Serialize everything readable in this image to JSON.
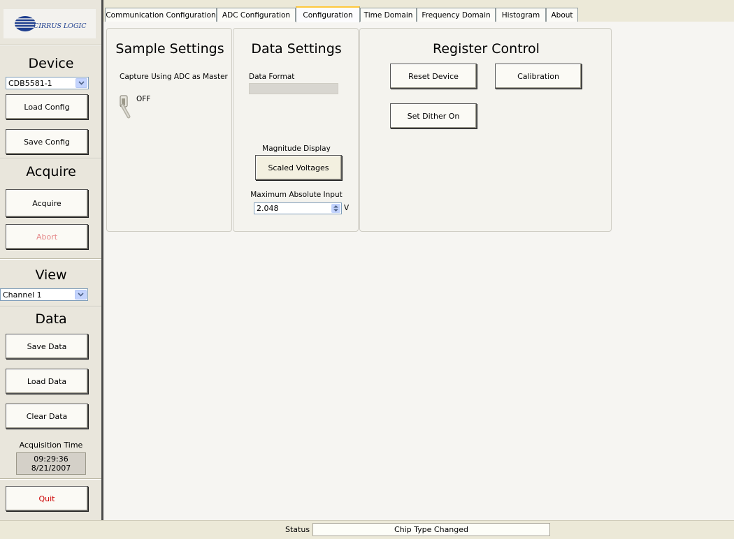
{
  "sidebar": {
    "logo_text": "CIRRUS LOGIC",
    "device": {
      "title": "Device",
      "select_value": "CDB5581-1",
      "load_config": "Load Config",
      "save_config": "Save Config"
    },
    "acquire": {
      "title": "Acquire",
      "acquire_button": "Acquire",
      "abort_button": "Abort"
    },
    "view": {
      "title": "View",
      "select_value": "Channel 1"
    },
    "data": {
      "title": "Data",
      "save_data": "Save Data",
      "load_data": "Load Data",
      "clear_data": "Clear Data"
    },
    "acquisition_time": {
      "label": "Acquisition Time",
      "time": "09:29:36",
      "date": "8/21/2007"
    },
    "quit_button": "Quit"
  },
  "tabs": [
    {
      "label": "Communication Configuration",
      "active": false
    },
    {
      "label": "ADC Configuration",
      "active": false
    },
    {
      "label": "Configuration",
      "active": true
    },
    {
      "label": "Time Domain",
      "active": false
    },
    {
      "label": "Frequency Domain",
      "active": false
    },
    {
      "label": "Histogram",
      "active": false
    },
    {
      "label": "About",
      "active": false
    }
  ],
  "sample_settings": {
    "title": "Sample Settings",
    "capture_label": "Capture Using ADC as Master",
    "toggle_state": "OFF"
  },
  "data_settings": {
    "title": "Data Settings",
    "data_format_label": "Data Format",
    "data_format_value": "",
    "magnitude_label": "Magnitude Display",
    "magnitude_button": "Scaled Voltages",
    "max_input_label": "Maximum Absolute Input",
    "max_input_value": "2.048",
    "max_input_unit": "V"
  },
  "register_control": {
    "title": "Register Control",
    "reset_button": "Reset Device",
    "calibration_button": "Calibration",
    "dither_button": "Set Dither On"
  },
  "status_bar": {
    "label": "Status",
    "value": "Chip Type Changed"
  }
}
